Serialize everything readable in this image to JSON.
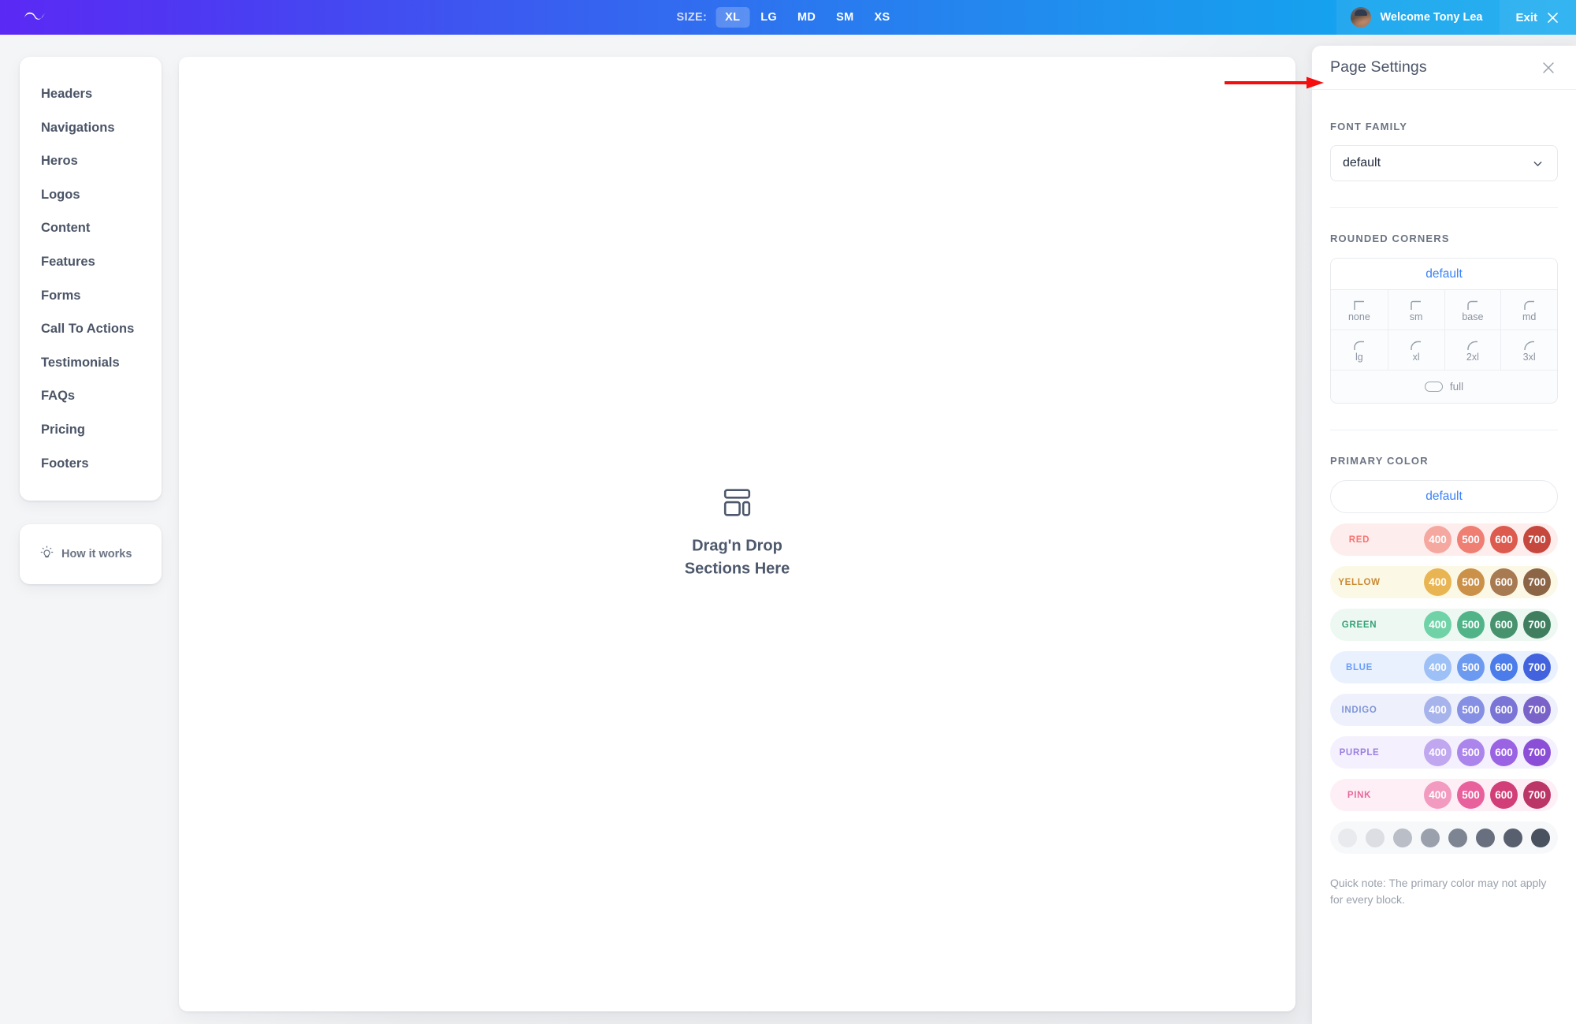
{
  "topbar": {
    "logo_icon": "tailwind-wave-logo",
    "size_label": "SIZE:",
    "sizes": [
      {
        "label": "XL",
        "active": true
      },
      {
        "label": "LG",
        "active": false
      },
      {
        "label": "MD",
        "active": false
      },
      {
        "label": "SM",
        "active": false
      },
      {
        "label": "XS",
        "active": false
      }
    ],
    "welcome": "Welcome Tony Lea",
    "exit": "Exit"
  },
  "sidebar": {
    "items": [
      {
        "label": "Headers"
      },
      {
        "label": "Navigations"
      },
      {
        "label": "Heros"
      },
      {
        "label": "Logos"
      },
      {
        "label": "Content"
      },
      {
        "label": "Features"
      },
      {
        "label": "Forms"
      },
      {
        "label": "Call To Actions"
      },
      {
        "label": "Testimonials"
      },
      {
        "label": "FAQs"
      },
      {
        "label": "Pricing"
      },
      {
        "label": "Footers"
      }
    ],
    "how_it_works": "How it works"
  },
  "canvas": {
    "dropzone_icon": "layout-blocks-icon",
    "dropzone_line1": "Drag'n Drop",
    "dropzone_line2": "Sections Here"
  },
  "panel": {
    "title": "Page Settings",
    "close_icon": "close-icon",
    "font_family": {
      "label": "FONT FAMILY",
      "value": "default"
    },
    "rounded_corners": {
      "label": "ROUNDED CORNERS",
      "default_label": "default",
      "options": [
        {
          "label": "none",
          "radius": 0
        },
        {
          "label": "sm",
          "radius": 2
        },
        {
          "label": "base",
          "radius": 4
        },
        {
          "label": "md",
          "radius": 6
        },
        {
          "label": "lg",
          "radius": 8
        },
        {
          "label": "xl",
          "radius": 12
        },
        {
          "label": "2xl",
          "radius": 16
        },
        {
          "label": "3xl",
          "radius": 22
        }
      ],
      "full_label": "full"
    },
    "primary_color": {
      "label": "PRIMARY COLOR",
      "default_label": "default",
      "accent_default": "#3b82f6",
      "rows": [
        {
          "name": "RED",
          "name_color": "#f87171",
          "bg": "#fdeeed",
          "shades": [
            {
              "label": "400",
              "color": "#f5a8a0"
            },
            {
              "label": "500",
              "color": "#ef7e73"
            },
            {
              "label": "600",
              "color": "#dd5a4e"
            },
            {
              "label": "700",
              "color": "#c6473e"
            }
          ]
        },
        {
          "name": "YELLOW",
          "name_color": "#c98a33",
          "bg": "#fcf8e6",
          "shades": [
            {
              "label": "400",
              "color": "#e9b552"
            },
            {
              "label": "500",
              "color": "#cb9149"
            },
            {
              "label": "600",
              "color": "#a87a52"
            },
            {
              "label": "700",
              "color": "#8c6546"
            }
          ]
        },
        {
          "name": "GREEN",
          "name_color": "#34a177",
          "bg": "#eef8f3",
          "shades": [
            {
              "label": "400",
              "color": "#6fd3a7"
            },
            {
              "label": "500",
              "color": "#51b488"
            },
            {
              "label": "600",
              "color": "#46936e"
            },
            {
              "label": "700",
              "color": "#3f7f60"
            }
          ]
        },
        {
          "name": "BLUE",
          "name_color": "#6b9dfa",
          "bg": "#eaf1fe",
          "shades": [
            {
              "label": "400",
              "color": "#9dc0f7"
            },
            {
              "label": "500",
              "color": "#6d9af1"
            },
            {
              "label": "600",
              "color": "#4b7ce9"
            },
            {
              "label": "700",
              "color": "#4263dd"
            }
          ]
        },
        {
          "name": "INDIGO",
          "name_color": "#8095d8",
          "bg": "#eef1fb",
          "shades": [
            {
              "label": "400",
              "color": "#a7b4ec"
            },
            {
              "label": "500",
              "color": "#8590e4"
            },
            {
              "label": "600",
              "color": "#7a74d6"
            },
            {
              "label": "700",
              "color": "#7963c9"
            }
          ]
        },
        {
          "name": "PURPLE",
          "name_color": "#9b7fe0",
          "bg": "#f4f0fd",
          "shades": [
            {
              "label": "400",
              "color": "#c0a7ef"
            },
            {
              "label": "500",
              "color": "#ab85ec"
            },
            {
              "label": "600",
              "color": "#9a63e4"
            },
            {
              "label": "700",
              "color": "#8a4fd6"
            }
          ]
        },
        {
          "name": "PINK",
          "name_color": "#e8689c",
          "bg": "#fdeff5",
          "shades": [
            {
              "label": "400",
              "color": "#f29ac0"
            },
            {
              "label": "500",
              "color": "#e9619c"
            },
            {
              "label": "600",
              "color": "#d23e77"
            },
            {
              "label": "700",
              "color": "#bb3566"
            }
          ]
        }
      ],
      "grays": [
        {
          "color": "#e9eaee"
        },
        {
          "color": "#dcdee3"
        },
        {
          "color": "#b9bec7"
        },
        {
          "color": "#9aa1ad"
        },
        {
          "color": "#7d8593"
        },
        {
          "color": "#68707f"
        },
        {
          "color": "#585f6e"
        },
        {
          "color": "#4a515f"
        }
      ],
      "quick_note": "Quick note: The primary color may not apply for every block."
    }
  }
}
